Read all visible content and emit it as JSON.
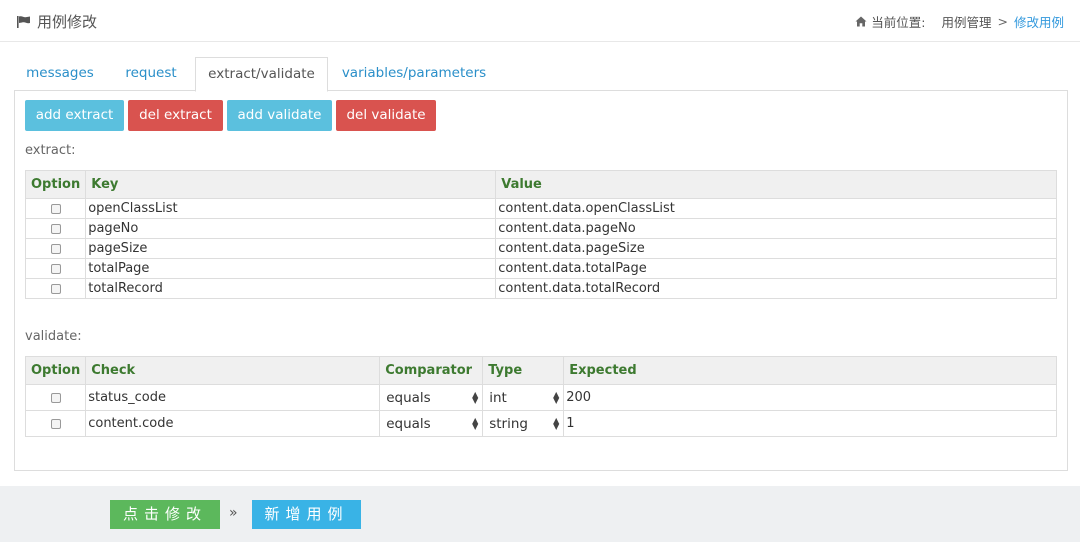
{
  "header": {
    "title": "用例修改",
    "breadcrumb": {
      "prefix": "当前位置:",
      "parent": "用例管理",
      "separator": ">",
      "current": "修改用例"
    }
  },
  "tabs": [
    {
      "label": "messages"
    },
    {
      "label": "request"
    },
    {
      "label": "extract/validate"
    },
    {
      "label": "variables/parameters"
    }
  ],
  "toolbar": {
    "add_extract": "add extract",
    "del_extract": "del extract",
    "add_validate": "add validate",
    "del_validate": "del validate"
  },
  "extract": {
    "label": "extract:",
    "headers": [
      "Option",
      "Key",
      "Value"
    ],
    "rows": [
      {
        "key": "openClassList",
        "value": "content.data.openClassList"
      },
      {
        "key": "pageNo",
        "value": "content.data.pageNo"
      },
      {
        "key": "pageSize",
        "value": "content.data.pageSize"
      },
      {
        "key": "totalPage",
        "value": "content.data.totalPage"
      },
      {
        "key": "totalRecord",
        "value": "content.data.totalRecord"
      }
    ]
  },
  "validate": {
    "label": "validate:",
    "headers": [
      "Option",
      "Check",
      "Comparator",
      "Type",
      "Expected"
    ],
    "rows": [
      {
        "check": "status_code",
        "comparator": "equals",
        "type": "int",
        "expected": "200"
      },
      {
        "check": "content.code",
        "comparator": "equals",
        "type": "string",
        "expected": "1"
      }
    ]
  },
  "footer": {
    "submit": "点击修改",
    "raquo": "»",
    "add_case": "新增用例"
  }
}
